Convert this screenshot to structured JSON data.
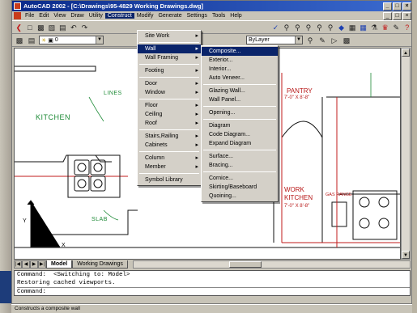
{
  "window": {
    "title": "AutoCAD 2002 - [C:\\Drawings\\95-4829 Working Drawings.dwg]"
  },
  "menubar": {
    "items": [
      "File",
      "Edit",
      "View",
      "Draw",
      "Utility",
      "Construct",
      "Modify",
      "Generate",
      "Settings",
      "Tools",
      "Help"
    ],
    "active": "Construct"
  },
  "layer": {
    "name": "0",
    "linetype": "ByLayer"
  },
  "construct_menu": {
    "items": [
      {
        "label": "Site Work",
        "submenu": true
      },
      {
        "label": "Wall",
        "submenu": true,
        "highlighted": true
      },
      {
        "label": "Wall Framing",
        "submenu": true
      },
      {
        "label": "Footing",
        "submenu": true
      },
      {
        "label": "Door",
        "submenu": true
      },
      {
        "label": "Window",
        "submenu": true
      },
      {
        "label": "Floor",
        "submenu": true
      },
      {
        "label": "Ceiling",
        "submenu": true
      },
      {
        "label": "Roof",
        "submenu": true
      },
      {
        "label": "Stairs,Railing",
        "submenu": true
      },
      {
        "label": "Cabinets",
        "submenu": true
      },
      {
        "label": "Column",
        "submenu": true
      },
      {
        "label": "Member",
        "submenu": true
      },
      {
        "label": "Symbol Library",
        "submenu": false
      }
    ]
  },
  "wall_submenu": {
    "items": [
      {
        "label": "Composite...",
        "highlighted": true
      },
      {
        "label": "Exterior..."
      },
      {
        "label": "Interior..."
      },
      {
        "label": "Auto Veneer..."
      },
      {
        "label": "Glazing Wall..."
      },
      {
        "label": "Wall Panel..."
      },
      {
        "label": "Opening..."
      },
      {
        "label": "Diagram"
      },
      {
        "label": "Code Diagram..."
      },
      {
        "label": "Expand Diagram"
      },
      {
        "label": "Surface..."
      },
      {
        "label": "Bracing..."
      },
      {
        "label": "Cornice..."
      },
      {
        "label": "Skirting/Baseboard"
      },
      {
        "label": "Quoining..."
      }
    ]
  },
  "drawing": {
    "labels": {
      "kitchen_left": "KITCHEN",
      "lines": "LINES",
      "slab": "SLAB",
      "pantry": "PANTRY",
      "pantry_dim": "7'-0\" X 8'-8\"",
      "work_kitchen": "WORK KITCHEN",
      "work_kitchen_dim": "7'-0\" X 8'-8\"",
      "gas_range": "GAS RANGE",
      "axis_y": "Y",
      "axis_x": "X"
    }
  },
  "tabs": {
    "items": [
      "Model",
      "Working Drawings"
    ],
    "active": "Model"
  },
  "command": {
    "lines": [
      "Command:  <Switching to: Model>",
      "Restoring cached viewports.",
      "Command:"
    ]
  },
  "status": {
    "text": "Constructs a composite wall"
  },
  "colors": {
    "title_bar": "#0a246a",
    "highlight": "#0a246a",
    "menu_bg": "#d4d0c8",
    "plan_green": "#1d8a36",
    "plan_red": "#b71616"
  }
}
